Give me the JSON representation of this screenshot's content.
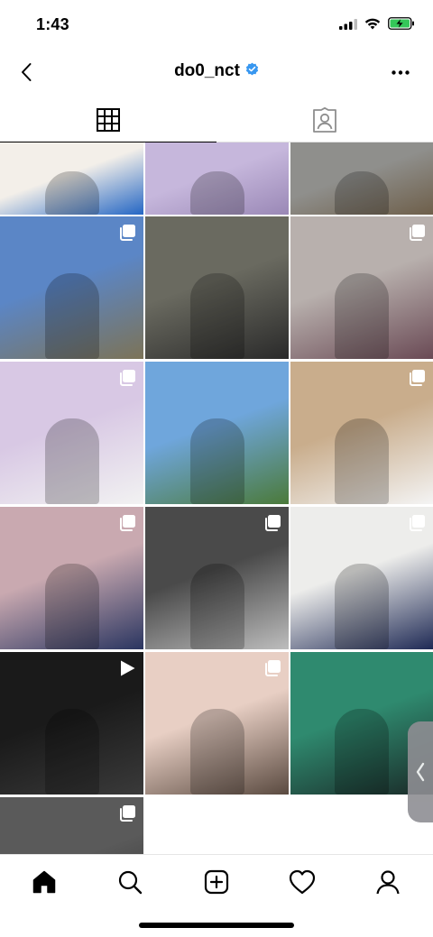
{
  "status": {
    "time": "1:43"
  },
  "header": {
    "username": "do0_nct",
    "verified": true
  },
  "tabs": [
    {
      "name": "grid",
      "icon": "grid-icon",
      "active": true
    },
    {
      "name": "tagged",
      "icon": "tagged-person-icon",
      "active": false
    }
  ],
  "posts": [
    {
      "row": 0,
      "col": 0,
      "type": "image",
      "colors": [
        "#f3efe9",
        "#2466c4"
      ]
    },
    {
      "row": 0,
      "col": 1,
      "type": "image",
      "colors": [
        "#c6b7dc",
        "#9a88b6"
      ]
    },
    {
      "row": 0,
      "col": 2,
      "type": "image",
      "colors": [
        "#8f8f8c",
        "#6e5f4a"
      ]
    },
    {
      "row": 1,
      "col": 0,
      "type": "carousel",
      "colors": [
        "#5b86c6",
        "#7c7357"
      ]
    },
    {
      "row": 1,
      "col": 1,
      "type": "image",
      "colors": [
        "#6a6a60",
        "#2a2a2a"
      ]
    },
    {
      "row": 1,
      "col": 2,
      "type": "carousel",
      "colors": [
        "#b8b0ad",
        "#6a4a55"
      ]
    },
    {
      "row": 2,
      "col": 0,
      "type": "carousel",
      "colors": [
        "#d8c8e4",
        "#f2f2f2"
      ]
    },
    {
      "row": 2,
      "col": 1,
      "type": "image",
      "colors": [
        "#6fa6dc",
        "#4b7a3a"
      ]
    },
    {
      "row": 2,
      "col": 2,
      "type": "carousel",
      "colors": [
        "#c9ad8c",
        "#f4f4f4"
      ]
    },
    {
      "row": 3,
      "col": 0,
      "type": "carousel",
      "colors": [
        "#c9a9b0",
        "#2a3560"
      ]
    },
    {
      "row": 3,
      "col": 1,
      "type": "carousel",
      "colors": [
        "#4a4a4a",
        "#bdbdbd"
      ]
    },
    {
      "row": 3,
      "col": 2,
      "type": "carousel",
      "colors": [
        "#ededeb",
        "#1f2a55"
      ]
    },
    {
      "row": 4,
      "col": 0,
      "type": "video",
      "colors": [
        "#1a1a1a",
        "#3a3a3a"
      ]
    },
    {
      "row": 4,
      "col": 1,
      "type": "carousel",
      "colors": [
        "#e8cfc4",
        "#5a4a40"
      ]
    },
    {
      "row": 4,
      "col": 2,
      "type": "image",
      "colors": [
        "#2f8a6f",
        "#1a2a28"
      ]
    },
    {
      "row": 5,
      "col": 0,
      "type": "carousel",
      "colors": [
        "#5a5a5a",
        "#2a2a2a"
      ]
    }
  ],
  "bottom_nav": [
    {
      "name": "home",
      "icon": "home-icon",
      "active": true
    },
    {
      "name": "search",
      "icon": "search-icon",
      "active": false
    },
    {
      "name": "new-post",
      "icon": "add-post-icon",
      "active": false
    },
    {
      "name": "activity",
      "icon": "heart-icon",
      "active": false
    },
    {
      "name": "profile",
      "icon": "profile-icon",
      "active": false
    }
  ]
}
